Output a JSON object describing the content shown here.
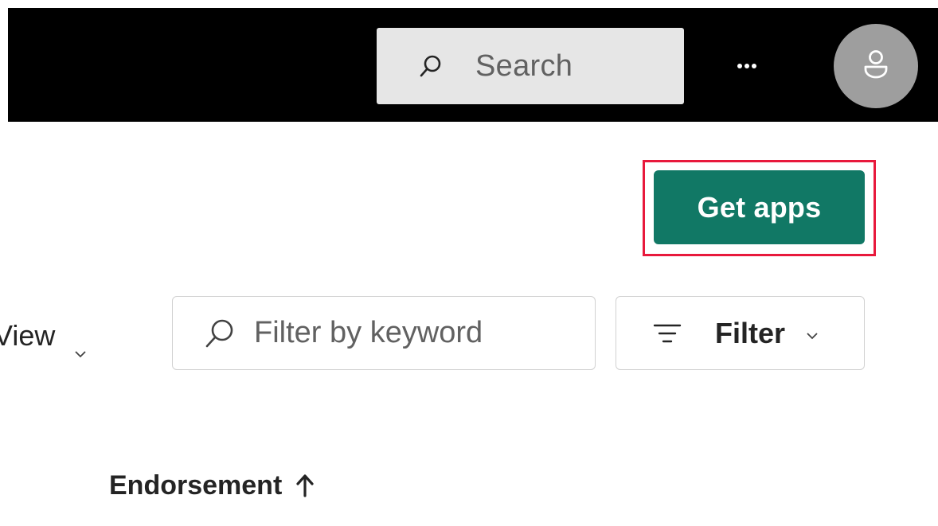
{
  "header": {
    "search_placeholder": "Search",
    "more_label": "...",
    "icons": {
      "search": "search-icon",
      "more": "more-icon",
      "avatar": "person-icon"
    }
  },
  "actions": {
    "get_apps_label": "Get apps",
    "get_apps_color": "#117865",
    "highlight_color": "#e8193c"
  },
  "toolbar": {
    "view_label": "View",
    "keyword_placeholder": "Filter by keyword",
    "filter_label": "Filter",
    "icons": {
      "view_chevron": "chevron-down-icon",
      "keyword_search": "search-icon",
      "filter": "filter-icon",
      "filter_chevron": "chevron-down-icon"
    }
  },
  "table": {
    "columns": [
      {
        "label": "Endorsement",
        "sort": "ascending"
      }
    ]
  }
}
